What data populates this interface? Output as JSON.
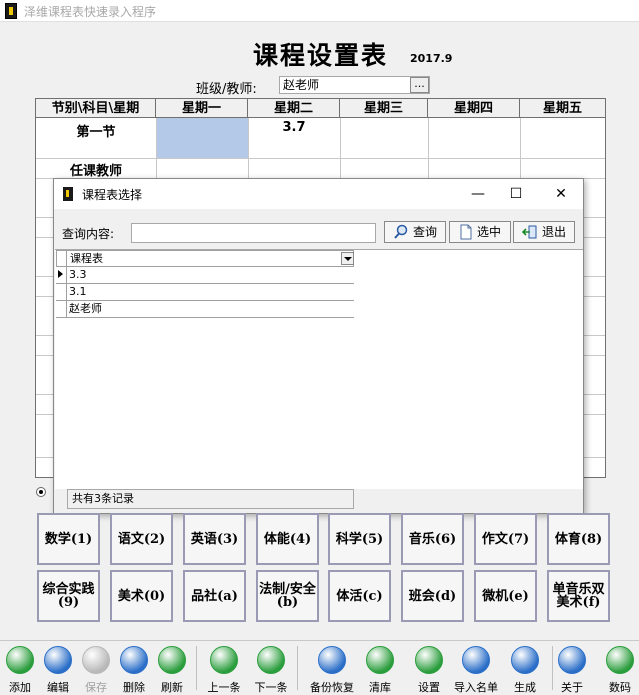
{
  "window": {
    "title": "泽维课程表快速录入程序"
  },
  "header": {
    "title": "课程设置表",
    "version": "2017.9",
    "class_label": "班级/教师:",
    "class_value": "赵老师",
    "browse_label": "..."
  },
  "grid": {
    "headers": [
      "节别\\科目\\星期",
      "星期一",
      "星期二",
      "星期三",
      "星期四",
      "星期五"
    ],
    "rows": [
      {
        "label": "第一节",
        "cells": [
          "",
          "3.7",
          "",
          "",
          ""
        ]
      },
      {
        "label": "任课教师",
        "cells": [
          "",
          "",
          "",
          "",
          ""
        ]
      }
    ],
    "selected_color": "#b4c8e8"
  },
  "dialog": {
    "title": "课程表选择",
    "controls": {
      "minimize": "—",
      "maximize": "☐",
      "close": "✕"
    },
    "query_label": "查询内容:",
    "query_value": "",
    "btn_query": "查询",
    "btn_select": "选中",
    "btn_exit": "退出",
    "column": "课程表",
    "items": [
      "3.3",
      "3.1",
      "赵老师"
    ],
    "status": "共有3条记录"
  },
  "subjects": [
    [
      "数学(1)",
      "语文(2)",
      "英语(3)",
      "体能(4)",
      "科学(5)",
      "音乐(6)",
      "作文(7)",
      "体育(8)"
    ],
    [
      "综合实践(9)",
      "美术(0)",
      "品社(a)",
      "法制/安全(b)",
      "体活(c)",
      "班会(d)",
      "微机(e)",
      "单音乐双美术(f)"
    ]
  ],
  "toolbar": [
    {
      "label": "添加",
      "icon": "add-icon",
      "color": "#2a9d3c"
    },
    {
      "label": "编辑",
      "icon": "pen-icon",
      "color": "#2a6ec8"
    },
    {
      "label": "保存",
      "icon": "save-icon",
      "color": "#b8b8b8",
      "disabled": true
    },
    {
      "label": "删除",
      "icon": "delete-icon",
      "color": "#2a6ec8"
    },
    {
      "label": "刷新",
      "icon": "refresh-icon",
      "color": "#2a9d3c"
    },
    {
      "label": "上一条",
      "icon": "prev-icon",
      "color": "#2a9d3c"
    },
    {
      "label": "下一条",
      "icon": "next-icon",
      "color": "#2a9d3c"
    },
    {
      "label": "备份恢复",
      "icon": "backup-icon",
      "color": "#2a6ec8"
    },
    {
      "label": "清库",
      "icon": "clear-icon",
      "color": "#2a9d3c"
    },
    {
      "label": "设置",
      "icon": "settings-icon",
      "color": "#2a9d3c"
    },
    {
      "label": "导入名单",
      "icon": "import-icon",
      "color": "#2a6ec8"
    },
    {
      "label": "生成",
      "icon": "generate-icon",
      "color": "#2a6ec8"
    },
    {
      "label": "关于",
      "icon": "mail-icon",
      "color": "#2a6ec8"
    },
    {
      "label": "数码",
      "icon": "digital-icon",
      "color": "#2a9d3c"
    }
  ]
}
